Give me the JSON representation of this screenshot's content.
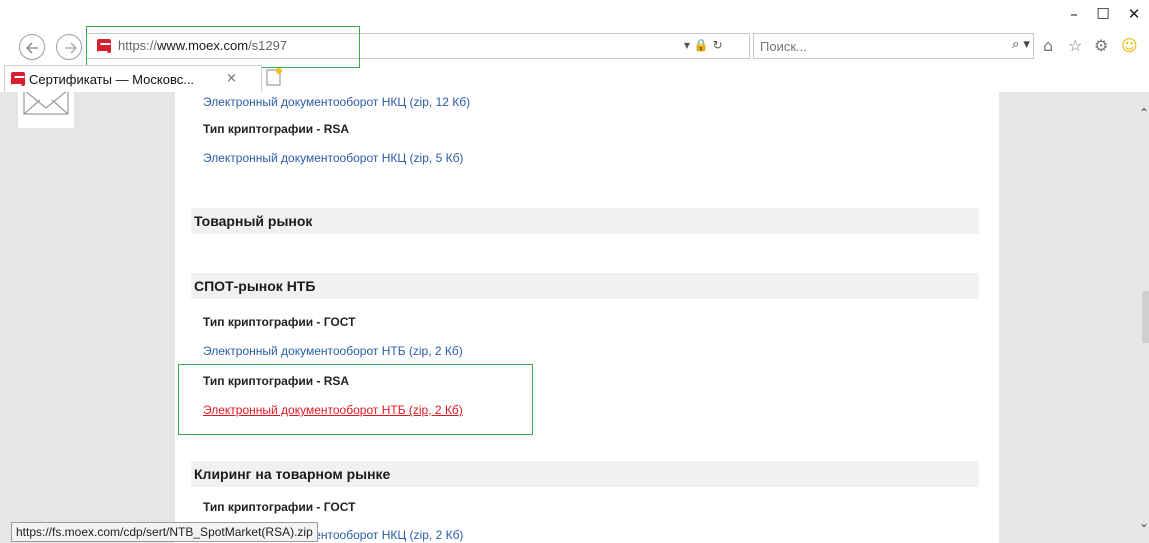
{
  "window": {
    "minimize": "–",
    "maximize": "☐",
    "close": "✕"
  },
  "address_bar": {
    "url_prefix": "https://",
    "url_domain": "www.moex.com",
    "url_path": "/s1297",
    "icons": "▾ 🔒 ↻"
  },
  "search": {
    "placeholder": "Поиск...",
    "icon": "⌕ ▾"
  },
  "toolbar": {
    "home": "⌂",
    "favorites": "☆",
    "settings": "⚙",
    "smiley": "☺"
  },
  "tab": {
    "title": "Сертификаты — Московс...",
    "close": "×"
  },
  "page": {
    "rows": [
      {
        "kind": "link",
        "text": "Электронный документооборот НКЦ (zip, 12 Кб)"
      },
      {
        "kind": "crypto",
        "text": "Тип криптографии - RSA"
      },
      {
        "kind": "link",
        "text": "Электронный документооборот НКЦ (zip, 5 Кб)"
      },
      {
        "kind": "section",
        "text": "Товарный рынок"
      },
      {
        "kind": "section",
        "text": "СПОТ-рынок НТБ"
      },
      {
        "kind": "crypto",
        "text": "Тип криптографии - ГОСТ"
      },
      {
        "kind": "link",
        "text": "Электронный документооборот НТБ (zip, 2 Кб)"
      },
      {
        "kind": "crypto",
        "text": "Тип криптографии - RSA"
      },
      {
        "kind": "link-hover",
        "text": "Электронный документооборот НТБ (zip, 2 Кб)"
      },
      {
        "kind": "section",
        "text": "Клиринг на товарном рынке"
      },
      {
        "kind": "crypto",
        "text": "Тип криптографии - ГОСТ"
      },
      {
        "kind": "link",
        "text": "Электронный документооборот НКЦ (zip, 2 Кб)"
      }
    ]
  },
  "status_bar": {
    "text": "https://fs.moex.com/cdp/sert/NTB_SpotMarket(RSA).zip"
  },
  "colors": {
    "link": "#2a5ca8",
    "link_hover": "#e0191f",
    "annotation": "#3cae49",
    "brand": "#d6202c"
  }
}
